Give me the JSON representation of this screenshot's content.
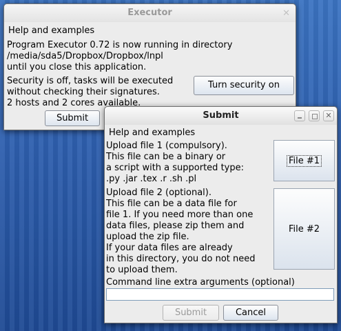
{
  "executor": {
    "title": "Executor",
    "menu": "Help and examples",
    "status_lines": [
      "Program Executor 0.72 is now running in directory",
      "/media/sda5/Dropbox/Dropbox/lnpl",
      "until you close this application."
    ],
    "security_lines": [
      "Security is off, tasks will be executed",
      "without checking their signatures.",
      "2 hosts and 2 cores available."
    ],
    "security_button": "Turn security on",
    "submit_button": "Submit"
  },
  "submit_dialog": {
    "title": "Submit",
    "menu": "Help and examples",
    "file1_lines": [
      "Upload file 1 (compulsory).",
      "This file can be a binary or",
      "a script with a supported type:",
      ".py .jar .tex .r .sh .pl"
    ],
    "file1_button": "File #1",
    "file2_lines": [
      "Upload file 2 (optional).",
      "This file can be a data file for",
      "file 1. If you need more than one",
      "data files, please zip them and",
      "upload the zip file.",
      "If your data files are already",
      "in this directory, you do not need",
      "to upload them."
    ],
    "file2_button": "File #2",
    "args_label": "Command line extra arguments (optional)",
    "args_value": "",
    "submit_button": "Submit",
    "cancel_button": "Cancel"
  }
}
